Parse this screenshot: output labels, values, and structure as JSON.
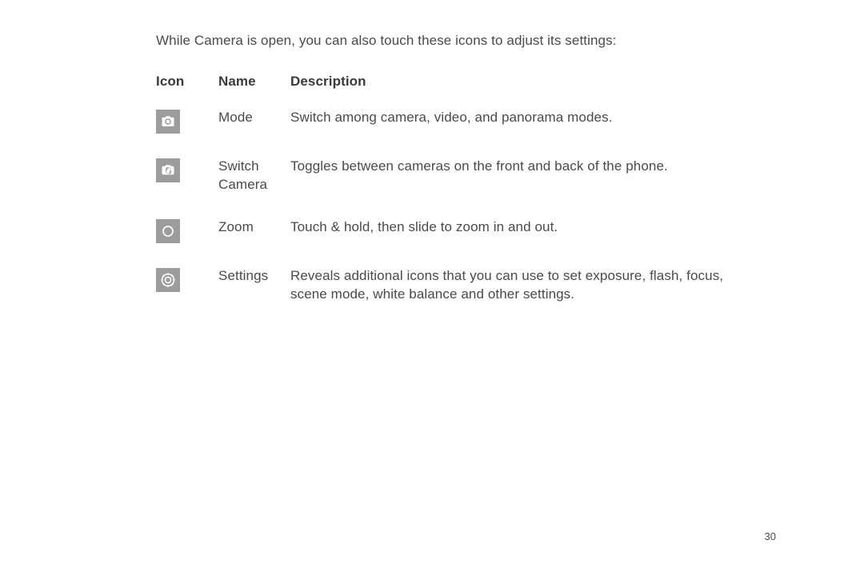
{
  "intro": "While Camera is open, you can also touch these icons to adjust its settings:",
  "headers": {
    "icon": "Icon",
    "name": "Name",
    "description": "Description"
  },
  "rows": [
    {
      "icon": "camera-icon",
      "name": "Mode",
      "description": "Switch among camera, video, and panorama modes."
    },
    {
      "icon": "switch-camera-icon",
      "name": "Switch Camera",
      "description": "Toggles between cameras on the front and back of the phone."
    },
    {
      "icon": "zoom-icon",
      "name": "Zoom",
      "description": "Touch & hold, then slide to zoom in and out."
    },
    {
      "icon": "settings-icon",
      "name": "Settings",
      "description": "Reveals additional icons that you can use to set exposure, flash, focus, scene mode, white balance and other settings."
    }
  ],
  "page_number": "30"
}
